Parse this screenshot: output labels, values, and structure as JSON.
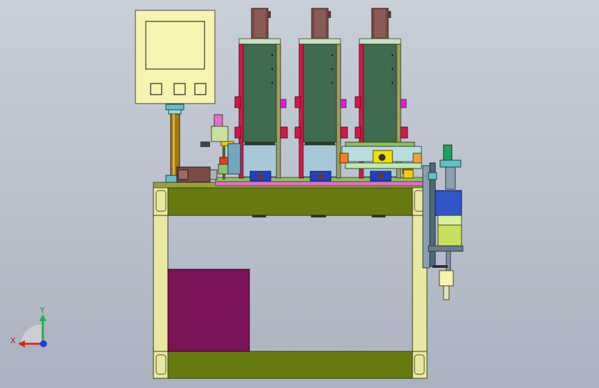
{
  "viewport": {
    "background_top": "#c9cfd8",
    "background_bottom": "#aab2bf"
  },
  "triad": {
    "x_label": "X",
    "y_label": "Y",
    "x_color": "#e02020",
    "y_color": "#1fb34a",
    "z_color": "#1f3fd0"
  },
  "colors": {
    "frame_yellow": "#e8e8a0",
    "olive_beam": "#667a10",
    "purple_panel": "#7a1456",
    "column_green": "#3f6b4e",
    "column_red": "#d01848",
    "motor_brown": "#7a4a45",
    "hmi_panel": "#f7f3b0",
    "magenta": "#e020d0",
    "blue_clamp": "#2040c0",
    "cyan_mount": "#60c0c8"
  },
  "hmi": {
    "buttons": [
      "button-1",
      "button-2",
      "button-3"
    ]
  },
  "columns": [
    "spindle-column-1",
    "spindle-column-2",
    "spindle-column-3"
  ]
}
